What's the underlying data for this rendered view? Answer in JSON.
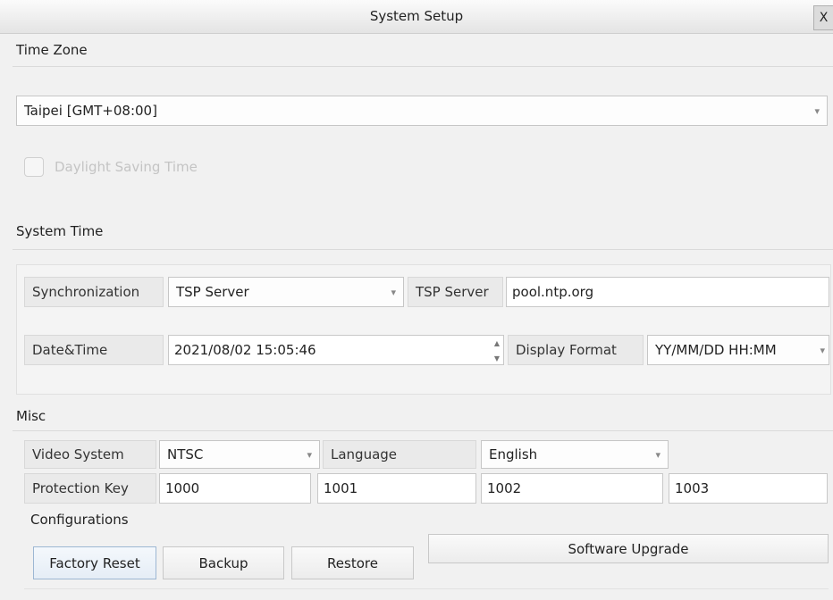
{
  "window": {
    "title": "System Setup",
    "close_label": "X"
  },
  "time_zone": {
    "section_label": "Time Zone",
    "selected": "Taipei [GMT+08:00]",
    "dst_label": "Daylight Saving Time",
    "dst_checked": false,
    "dst_enabled": false
  },
  "system_time": {
    "section_label": "System Time",
    "sync_label": "Synchronization",
    "sync_value": "TSP Server",
    "server_label": "TSP Server",
    "server_value": "pool.ntp.org",
    "datetime_label": "Date&Time",
    "datetime_value": "2021/08/02 15:05:46",
    "format_label": "Display Format",
    "format_value": "YY/MM/DD HH:MM"
  },
  "misc": {
    "section_label": "Misc",
    "video_label": "Video System",
    "video_value": "NTSC",
    "language_label": "Language",
    "language_value": "English",
    "protection_label": "Protection Key",
    "protection_keys": [
      "1000",
      "1001",
      "1002",
      "1003"
    ],
    "config_label": "Configurations",
    "factory_reset": "Factory Reset",
    "backup": "Backup",
    "restore": "Restore",
    "software_upgrade": "Software Upgrade"
  }
}
